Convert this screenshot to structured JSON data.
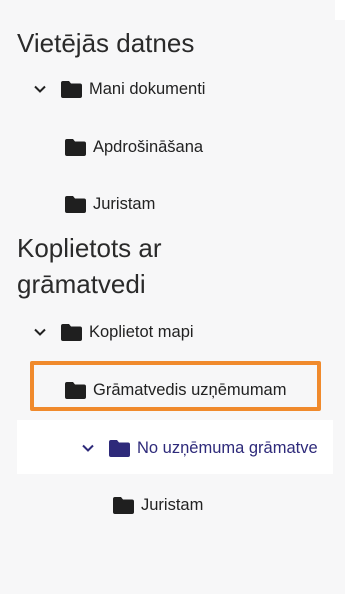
{
  "sections": {
    "local": {
      "title": "Vietējās datnes",
      "items": [
        {
          "label": "Mani dokumenti",
          "expanded": true
        },
        {
          "label": "Apdrošināšana"
        },
        {
          "label": "Juristam"
        }
      ]
    },
    "shared": {
      "title_line1": "Koplietots ar",
      "title_line2": "grāmatvedi",
      "items": [
        {
          "label": "Koplietot mapi",
          "expanded": true
        },
        {
          "label": "Grāmatvedis uzņēmumam"
        },
        {
          "label": "No uzņēmuma grāmatve",
          "expanded": true,
          "selected": true
        },
        {
          "label": "Juristam"
        }
      ]
    }
  },
  "colors": {
    "accent": "#2e2a7a",
    "highlight": "#f08a2c",
    "folder": "#1f1f1f",
    "background": "#f7f7f8"
  },
  "icons": {
    "folder": "folder-icon",
    "chevron": "chevron-down-icon"
  }
}
